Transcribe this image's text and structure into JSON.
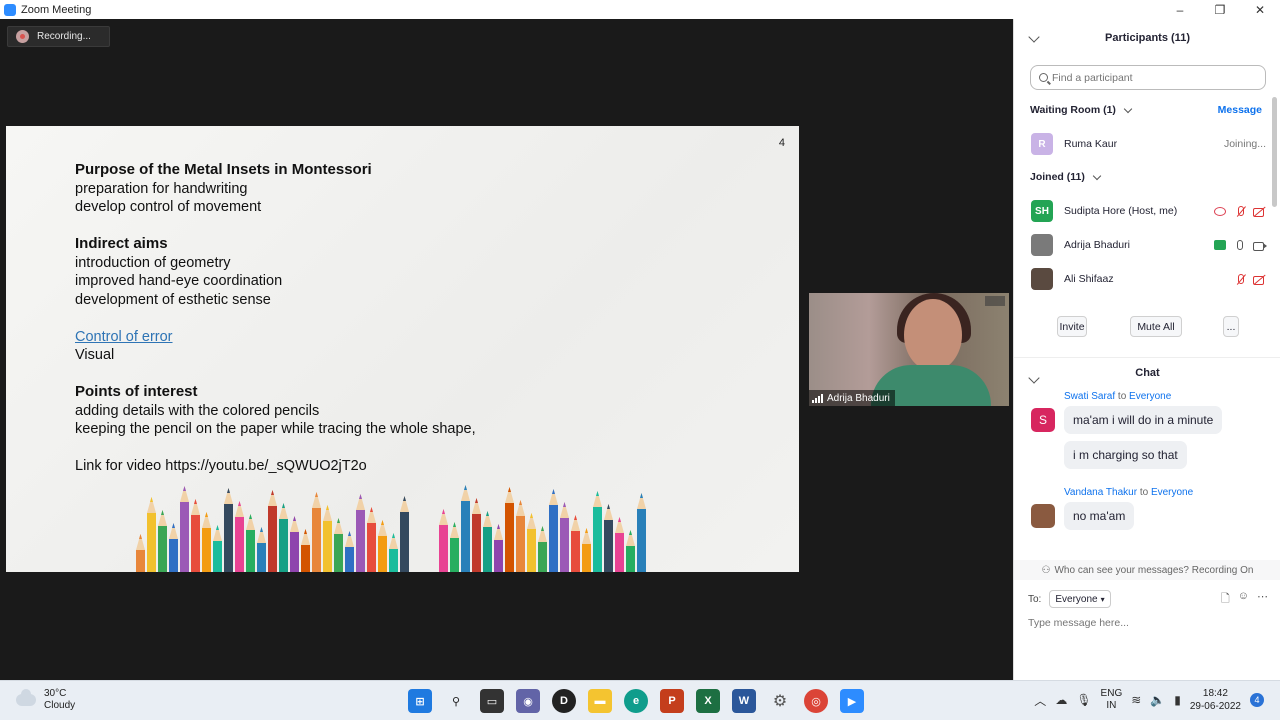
{
  "window": {
    "title": "Zoom Meeting",
    "controls": {
      "minimize": "–",
      "maximize": "❐",
      "close": "✕"
    }
  },
  "meeting": {
    "recording_label": "Recording...",
    "slide": {
      "page_number": "4",
      "heading1": "Purpose of the Metal Insets in Montessori",
      "lines1": [
        "preparation for handwriting",
        "develop control of movement"
      ],
      "heading2": "Indirect aims",
      "lines2": [
        "introduction of geometry",
        "improved hand-eye coordination",
        "development of esthetic sense"
      ],
      "link_text": "Control of error",
      "line3": "Visual",
      "heading4": "Points of interest",
      "lines4": [
        "adding details with the colored pencils",
        "keeping the pencil on the paper while tracing the whole shape,"
      ],
      "video_line": "Link for video https://youtu.be/_sQWUO2jT2o"
    },
    "video_tile": {
      "name": "Adrija Bhaduri"
    }
  },
  "participants": {
    "title": "Participants (11)",
    "search_placeholder": "Find a participant",
    "waiting_room_label": "Waiting Room (1)",
    "message_label": "Message",
    "waiting": [
      {
        "initial": "R",
        "name": "Ruma Kaur",
        "status": "Joining...",
        "color": "#c9b3e6"
      }
    ],
    "joined_label": "Joined (11)",
    "joined": [
      {
        "initial": "SH",
        "name": "Sudipta Hore (Host, me)",
        "color": "#23a454"
      },
      {
        "initial": "",
        "name": "Adrija Bhaduri",
        "color": "#7a7a7a"
      },
      {
        "initial": "",
        "name": "Ali Shifaaz",
        "color": "#5a4a40"
      }
    ],
    "buttons": {
      "invite": "Invite",
      "mute_all": "Mute All",
      "more": "..."
    }
  },
  "chat": {
    "title": "Chat",
    "messages": [
      {
        "sender": "Swati Saraf",
        "to_word": "to",
        "recipient": "Everyone",
        "avatar_initial": "S",
        "avatar_color": "#d7265f",
        "texts": [
          "ma'am i will do in a minute",
          "i m charging so that"
        ]
      },
      {
        "sender": "Vandana Thakur",
        "to_word": "to",
        "recipient": "Everyone",
        "avatar_initial": "",
        "avatar_color": "#8a5a40",
        "texts": [
          "no ma'am"
        ]
      }
    ],
    "privacy_note": "Who can see your messages? Recording On",
    "to_label": "To:",
    "to_value": "Everyone",
    "input_placeholder": "Type message here..."
  },
  "taskbar": {
    "temperature": "30°C",
    "weather": "Cloudy",
    "lang_line1": "ENG",
    "lang_line2": "IN",
    "time": "18:42",
    "date": "29-06-2022",
    "notifications": "4"
  },
  "colors": {
    "zoom_blue": "#0e72ed",
    "host_green": "#23a454",
    "muted_red": "#d33333"
  }
}
